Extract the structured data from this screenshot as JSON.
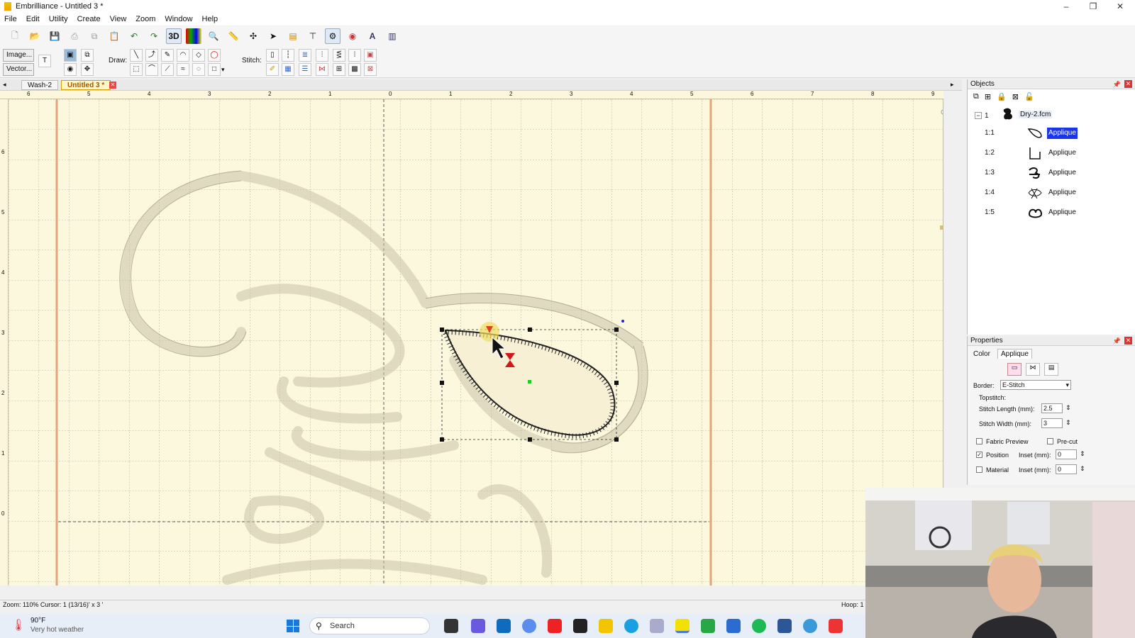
{
  "window": {
    "title": "Embrilliance - Untitled 3 *"
  },
  "menu": [
    "File",
    "Edit",
    "Utility",
    "Create",
    "View",
    "Zoom",
    "Window",
    "Help"
  ],
  "toolbar2": {
    "image_btn": "Image...",
    "vector_btn": "Vector...",
    "draw_label": "Draw:",
    "stitch_label": "Stitch:"
  },
  "tabs": [
    {
      "label": "Wash-2",
      "active": false
    },
    {
      "label": "Untitled 3 *",
      "active": true
    }
  ],
  "objects_panel": {
    "title": "Objects",
    "root": {
      "num": "1",
      "name": "Dry-2.fcm"
    },
    "items": [
      {
        "num": "1:1",
        "label": "Applique",
        "selected": true
      },
      {
        "num": "1:2",
        "label": "Applique",
        "selected": false
      },
      {
        "num": "1:3",
        "label": "Applique",
        "selected": false
      },
      {
        "num": "1:4",
        "label": "Applique",
        "selected": false
      },
      {
        "num": "1:5",
        "label": "Applique",
        "selected": false
      }
    ]
  },
  "properties_panel": {
    "title": "Properties",
    "tab_color": "Color",
    "tab_applique": "Applique",
    "border_label": "Border:",
    "border_value": "E-Stitch",
    "topstitch_label": "Topstitch:",
    "stitch_length_label": "Stitch Length (mm):",
    "stitch_length_value": "2.5",
    "stitch_width_label": "Stitch Width (mm):",
    "stitch_width_value": "3",
    "fabric_preview_label": "Fabric Preview",
    "precut_label": "Pre-cut",
    "position_label": "Position",
    "position_checked": true,
    "position_inset_label": "Inset (mm):",
    "position_inset_value": "0",
    "material_label": "Material",
    "material_inset_label": "Inset (mm):",
    "material_inset_value": "0"
  },
  "ruler": {
    "h_labels": [
      "6",
      "5",
      "4",
      "3",
      "2",
      "1",
      "0",
      "1",
      "2",
      "3",
      "4",
      "5",
      "6",
      "7",
      "8",
      "9"
    ],
    "v_labels": [
      "6",
      "5",
      "4",
      "3",
      "2",
      "1",
      "0"
    ]
  },
  "statusbar": {
    "zoom_cursor": "Zoom: 110%  Cursor: 1 (13/16)' x 3 '",
    "hoop": "Hoop: 1"
  },
  "taskbar": {
    "temp": "90°F",
    "weather": "Very hot weather",
    "search_placeholder": "Search"
  },
  "colors": {
    "canvas_bg": "#fcf8de",
    "selection_blue": "#1a34e8",
    "hoop_edge": "#e0a070"
  }
}
